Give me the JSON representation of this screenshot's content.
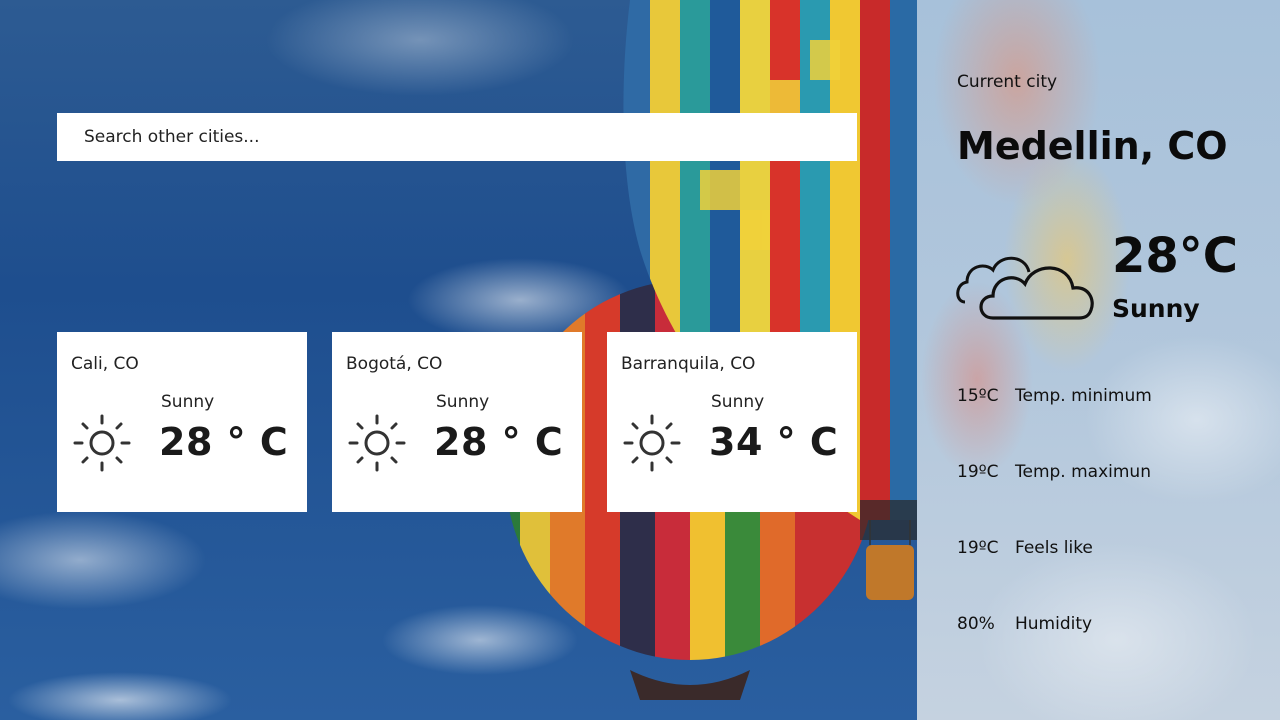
{
  "search": {
    "placeholder": "Search other cities..."
  },
  "cards": [
    {
      "city": "Cali, CO",
      "condition": "Sunny",
      "temp": "28 ° C",
      "icon": "sun-icon"
    },
    {
      "city": "Bogotá, CO",
      "condition": "Sunny",
      "temp": "28 ° C",
      "icon": "sun-icon"
    },
    {
      "city": "Barranquila, CO",
      "condition": "Sunny",
      "temp": "34 ° C",
      "icon": "sun-icon"
    }
  ],
  "current": {
    "label": "Current city",
    "city": "Medellin, CO",
    "temp": "28°C",
    "condition": "Sunny",
    "icon": "cloud-icon",
    "stats": [
      {
        "value": "15ºC",
        "label": "Temp. minimum"
      },
      {
        "value": "19ºC",
        "label": "Temp. maximun"
      },
      {
        "value": "19ºC",
        "label": "Feels like"
      },
      {
        "value": "80%",
        "label": "Humidity"
      }
    ]
  },
  "colors": {
    "card_bg": "#ffffff",
    "text": "#111111",
    "sky": "#1e4e8e",
    "side_panel": "#b2c7dc"
  }
}
